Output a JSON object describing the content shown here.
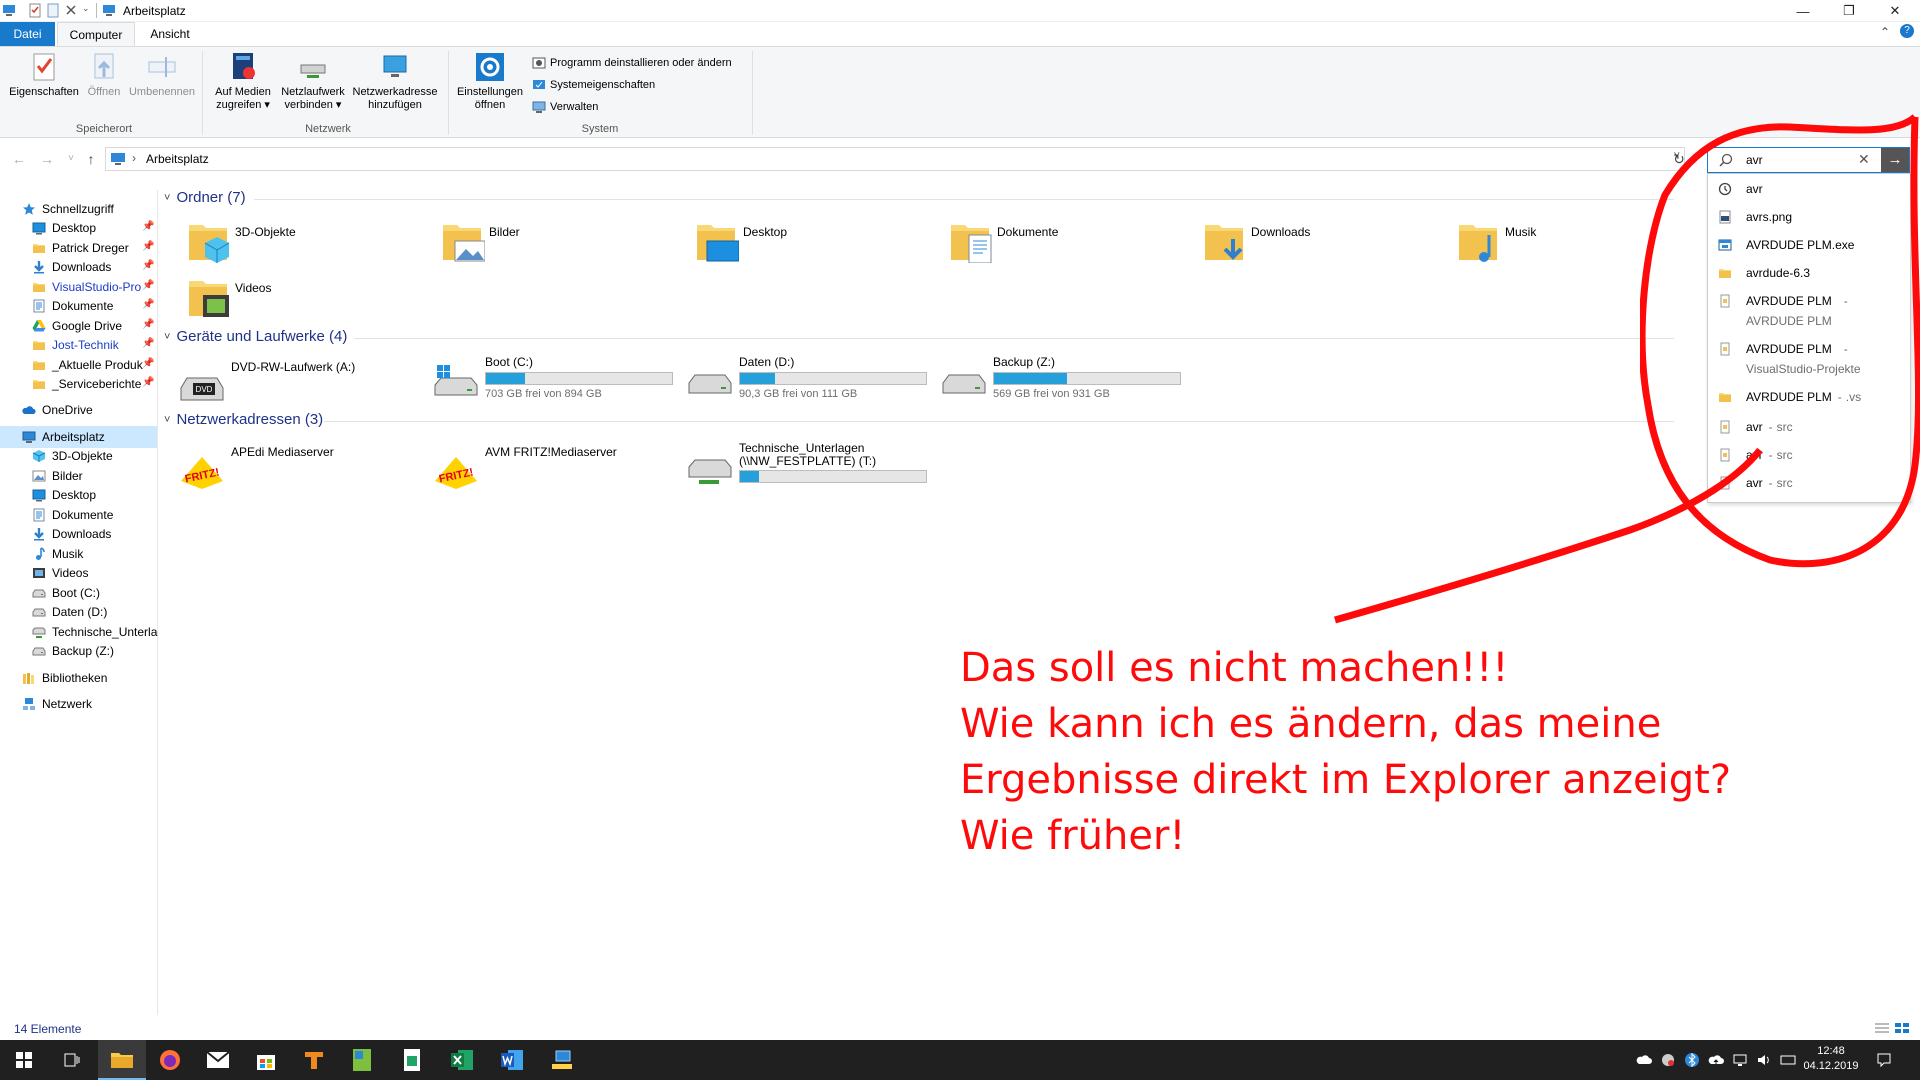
{
  "window": {
    "title": "Arbeitsplatz",
    "minimize_glyph": "—",
    "maximize_glyph": "❐",
    "close_glyph": "✕"
  },
  "ribbon_tabs": {
    "datei": "Datei",
    "computer": "Computer",
    "ansicht": "Ansicht",
    "collapse_glyph": "⌃",
    "help_glyph": "?"
  },
  "ribbon": {
    "groups": {
      "speicherort": "Speicherort",
      "netzwerk": "Netzwerk",
      "system": "System"
    },
    "eigenschaften": "Eigenschaften",
    "oeffnen": "Öffnen",
    "umbenennen": "Umbenennen",
    "auf_medien_1": "Auf Medien",
    "auf_medien_2": "zugreifen ▾",
    "netzlaufwerk_1": "Netzlaufwerk",
    "netzlaufwerk_2": "verbinden ▾",
    "netzwerkadresse_1": "Netzwerkadresse",
    "netzwerkadresse_2": "hinzufügen",
    "einstellungen_1": "Einstellungen",
    "einstellungen_2": "öffnen",
    "programm_deinstallieren": "Programm deinstallieren oder ändern",
    "systemeigenschaften": "Systemeigenschaften",
    "verwalten": "Verwalten"
  },
  "addressbar": {
    "back": "←",
    "forward": "→",
    "recent": "˅",
    "up": "↑",
    "separator": "›",
    "path": "Arbeitsplatz",
    "dropdown": "˅",
    "refresh": "↻"
  },
  "search": {
    "value": "avr",
    "clear": "✕",
    "go": "→"
  },
  "suggestions": [
    {
      "name": "avr",
      "sub": "",
      "icon": "history-icon"
    },
    {
      "name": "avrs.png",
      "sub": "",
      "icon": "png-file-icon"
    },
    {
      "name": "AVRDUDE PLM.exe",
      "sub": "",
      "icon": "exe-file-icon"
    },
    {
      "name": "avrdude-6.3",
      "sub": "",
      "icon": "folder-icon"
    },
    {
      "name": "AVRDUDE PLM",
      "sub": "AVRDUDE PLM",
      "icon": "file-icon"
    },
    {
      "name": "AVRDUDE PLM",
      "sub": "VisualStudio-Projekte",
      "icon": "file-icon"
    },
    {
      "name": "AVRDUDE PLM",
      "sub": ".vs",
      "icon": "folder-icon"
    },
    {
      "name": "avr",
      "sub": "src",
      "icon": "file-icon"
    },
    {
      "name": "avr",
      "sub": "src",
      "icon": "file-icon"
    },
    {
      "name": "avr",
      "sub": "src",
      "icon": "file-icon"
    }
  ],
  "suggestion_dash": "-",
  "nav": {
    "pin": "📌",
    "items": [
      {
        "label": "Schnellzugriff",
        "icon": "star-icon"
      },
      {
        "label": "Desktop",
        "icon": "desktop-icon"
      },
      {
        "label": "Patrick Dreger",
        "icon": "folder-icon"
      },
      {
        "label": "Downloads",
        "icon": "download-icon"
      },
      {
        "label": "VisualStudio-Pro",
        "icon": "folder-icon"
      },
      {
        "label": "Dokumente",
        "icon": "documents-icon"
      },
      {
        "label": "Google Drive",
        "icon": "google-drive-icon"
      },
      {
        "label": "Jost-Technik",
        "icon": "folder-icon"
      },
      {
        "label": "_Aktuelle Produk",
        "icon": "folder-icon"
      },
      {
        "label": "_Serviceberichte",
        "icon": "folder-icon"
      },
      {
        "label": "OneDrive",
        "icon": "cloud-icon"
      },
      {
        "label": "Arbeitsplatz",
        "icon": "computer-icon"
      },
      {
        "label": "3D-Objekte",
        "icon": "cube-icon"
      },
      {
        "label": "Bilder",
        "icon": "pictures-icon"
      },
      {
        "label": "Desktop",
        "icon": "desktop-icon"
      },
      {
        "label": "Dokumente",
        "icon": "documents-icon"
      },
      {
        "label": "Downloads",
        "icon": "download-icon"
      },
      {
        "label": "Musik",
        "icon": "music-icon"
      },
      {
        "label": "Videos",
        "icon": "videos-icon"
      },
      {
        "label": "Boot (C:)",
        "icon": "drive-icon"
      },
      {
        "label": "Daten (D:)",
        "icon": "drive-icon"
      },
      {
        "label": "Technische_Unterlag",
        "icon": "network-drive-icon"
      },
      {
        "label": "Backup (Z:)",
        "icon": "drive-icon"
      },
      {
        "label": "Bibliotheken",
        "icon": "library-icon"
      },
      {
        "label": "Netzwerk",
        "icon": "network-icon"
      }
    ]
  },
  "sections": {
    "chevron": "˅",
    "ordner": "Ordner (7)",
    "geraete": "Geräte und Laufwerke (4)",
    "netzwerk": "Netzwerkadressen (3)"
  },
  "folders": [
    {
      "label": "3D-Objekte",
      "icon": "cube-icon"
    },
    {
      "label": "Bilder",
      "icon": "pictures-icon"
    },
    {
      "label": "Desktop",
      "icon": "desktop-icon"
    },
    {
      "label": "Dokumente",
      "icon": "documents-icon"
    },
    {
      "label": "Downloads",
      "icon": "download-icon"
    },
    {
      "label": "Musik",
      "icon": "music-icon"
    },
    {
      "label": "Videos",
      "icon": "videos-icon"
    }
  ],
  "devices": [
    {
      "name": "DVD-RW-Laufwerk (A:)",
      "free": "",
      "used_fraction": null,
      "icon": "dvd-drive-icon",
      "badge": "DVD"
    },
    {
      "name": "Boot (C:)",
      "free": "703 GB frei von 894 GB",
      "used_fraction": 0.21,
      "icon": "windows-drive-icon"
    },
    {
      "name": "Daten (D:)",
      "free": "90,3 GB frei von 111 GB",
      "used_fraction": 0.19,
      "icon": "drive-icon"
    },
    {
      "name": "Backup (Z:)",
      "free": "569 GB frei von 931 GB",
      "used_fraction": 0.39,
      "icon": "drive-icon"
    }
  ],
  "network_locations": [
    {
      "name": "APEdi Mediaserver",
      "name2": "",
      "used_fraction": null,
      "icon": "fritz-icon",
      "badge": "FRITZ!"
    },
    {
      "name": "AVM FRITZ!Mediaserver",
      "name2": "",
      "used_fraction": null,
      "icon": "fritz-icon",
      "badge": "FRITZ!"
    },
    {
      "name": "Technische_Unterlagen",
      "name2": "(\\\\NW_FESTPLATTE) (T:)",
      "used_fraction": 0.1,
      "icon": "network-drive-icon"
    }
  ],
  "status": {
    "count": "14 Elemente"
  },
  "clock": {
    "time": "12:48",
    "date": "04.12.2019"
  },
  "annotation": {
    "line1": "Das soll es nicht machen!!!",
    "line2": "Wie kann  ich es ändern, das meine",
    "line3": "Ergebnisse direkt im Explorer anzeigt?",
    "line4": "Wie früher!",
    "color": "#ff0a0a"
  },
  "colors": {
    "accent": "#1979ca",
    "selection": "#cce8ff",
    "header_blue": "#1e3287",
    "drive_fill": "#26a0da"
  }
}
